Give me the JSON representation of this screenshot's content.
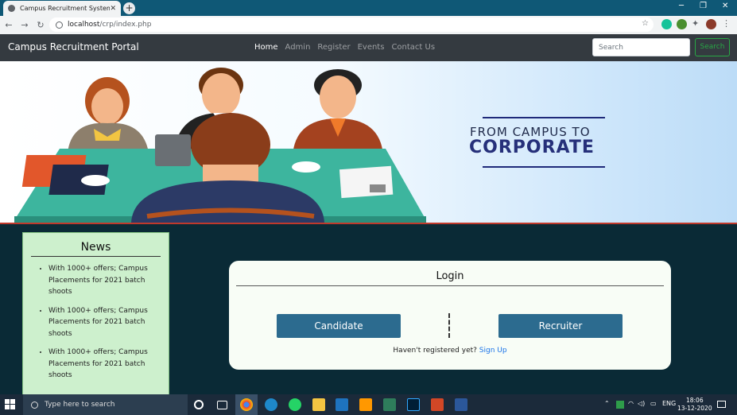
{
  "browser": {
    "tab_title": "Campus Recruitment System -",
    "tab_close": "✕",
    "new_tab": "+",
    "url_host": "localhost",
    "url_path": "/crp/index.php",
    "window_controls": [
      "─",
      "❐",
      "✕"
    ]
  },
  "navbar": {
    "brand": "Campus Recruitment Portal",
    "links": [
      "Home",
      "Admin",
      "Register",
      "Events",
      "Contact Us"
    ],
    "active_link": "Home",
    "search_placeholder": "Search",
    "search_button": "Search"
  },
  "hero": {
    "line1": "FROM CAMPUS TO",
    "line2": "CORPORATE"
  },
  "news": {
    "title": "News",
    "items": [
      "With 1000+ offers; Campus Placements for 2021 batch shoots",
      "With 1000+ offers; Campus Placements for 2021 batch shoots",
      "With 1000+ offers; Campus Placements for 2021 batch shoots"
    ]
  },
  "login": {
    "title": "Login",
    "candidate_button": "Candidate",
    "recruiter_button": "Recruiter",
    "register_prompt": "Haven't registered yet?",
    "signup_link": "Sign Up"
  },
  "taskbar": {
    "search_placeholder": "Type here to search",
    "language": "ENG",
    "time": "18:06",
    "date": "13-12-2020"
  },
  "colors": {
    "navbar": "#343a40",
    "main_bg": "#0a2a36",
    "news_bg": "#cdf0cd",
    "button": "#2c6b8f",
    "search_green": "#28a745",
    "hero_text": "#26307a"
  }
}
